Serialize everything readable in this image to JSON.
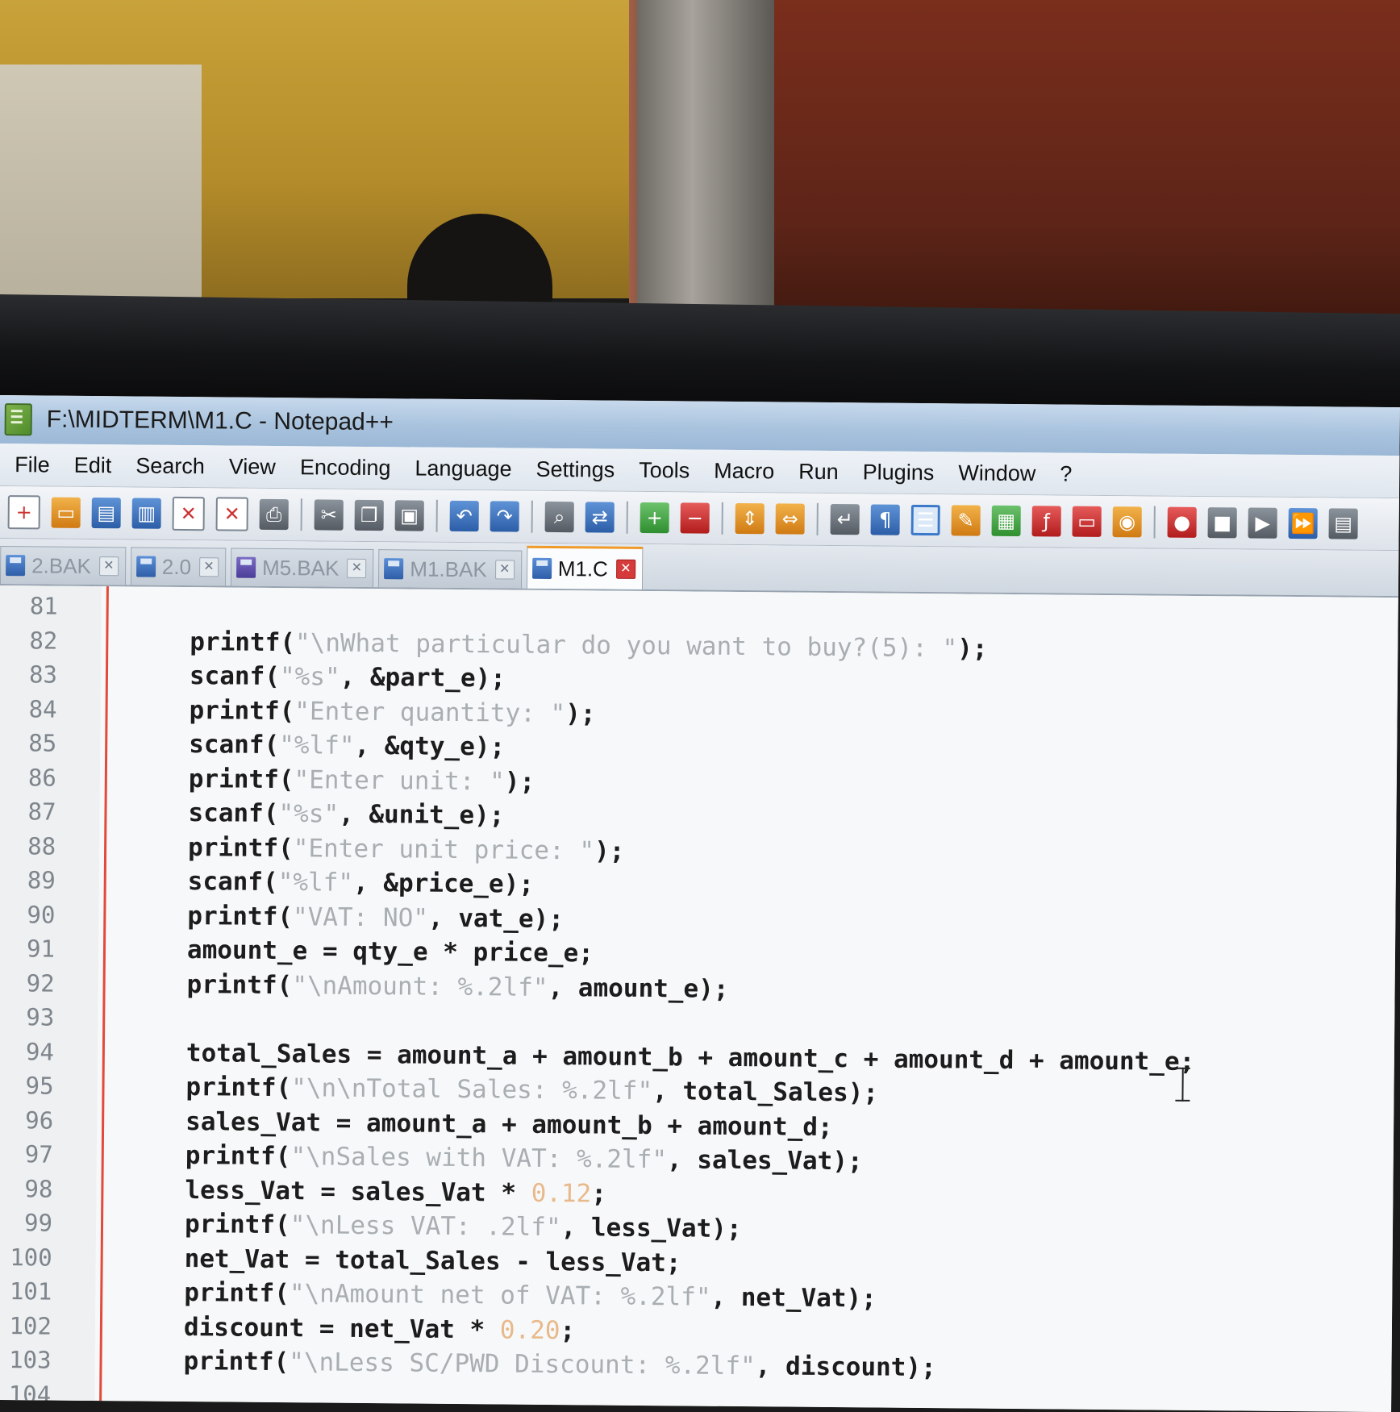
{
  "window": {
    "title": "F:\\MIDTERM\\M1.C - Notepad++"
  },
  "menu": [
    "File",
    "Edit",
    "Search",
    "View",
    "Encoding",
    "Language",
    "Settings",
    "Tools",
    "Macro",
    "Run",
    "Plugins",
    "Window",
    "?"
  ],
  "toolbar_icons": [
    "new-file-icon",
    "open-file-icon",
    "save-icon",
    "save-all-icon",
    "close-icon",
    "close-all-icon",
    "print-icon",
    "cut-icon",
    "copy-icon",
    "paste-icon",
    "undo-icon",
    "redo-icon",
    "find-icon",
    "replace-icon",
    "zoom-in-icon",
    "zoom-out-icon",
    "sync-vertical-icon",
    "sync-horizontal-icon",
    "word-wrap-icon",
    "show-all-characters-icon",
    "indent-guide-icon",
    "user-defined-language-icon",
    "document-map-icon",
    "function-list-icon",
    "folder-as-workspace-icon",
    "monitoring-icon",
    "record-macro-icon",
    "stop-recording-icon",
    "play-macro-icon",
    "run-macro-multiple-icon",
    "save-macro-icon"
  ],
  "tabs": [
    {
      "label": "2.BAK",
      "active": false
    },
    {
      "label": "2.0",
      "active": false
    },
    {
      "label": "M5.BAK",
      "active": false
    },
    {
      "label": "M1.BAK",
      "active": false
    },
    {
      "label": "M1.C",
      "active": true
    }
  ],
  "colors": {
    "fold_margin_line": "#e24a3b",
    "active_tab_accent": "#f09a2a",
    "string_literal": "#a9aeb3",
    "number_literal": "#e8b98a"
  },
  "lines": [
    {
      "n": "81",
      "code": ""
    },
    {
      "n": "82",
      "pre": "printf(",
      "str": "\"\\nWhat particular do you want to buy?(5): \"",
      "post": ");"
    },
    {
      "n": "83",
      "pre": "scanf(",
      "str": "\"%s\"",
      "post": ", &part_e);"
    },
    {
      "n": "84",
      "pre": "printf(",
      "str": "\"Enter quantity: \"",
      "post": ");"
    },
    {
      "n": "85",
      "pre": "scanf(",
      "str": "\"%lf\"",
      "post": ", &qty_e);"
    },
    {
      "n": "86",
      "pre": "printf(",
      "str": "\"Enter unit: \"",
      "post": ");"
    },
    {
      "n": "87",
      "pre": "scanf(",
      "str": "\"%s\"",
      "post": ", &unit_e);"
    },
    {
      "n": "88",
      "pre": "printf(",
      "str": "\"Enter unit price: \"",
      "post": ");"
    },
    {
      "n": "89",
      "pre": "scanf(",
      "str": "\"%lf\"",
      "post": ", &price_e);"
    },
    {
      "n": "90",
      "pre": "printf(",
      "str": "\"VAT: NO\"",
      "post": ", vat_e);"
    },
    {
      "n": "91",
      "pre": "amount_e = qty_e * price_e;",
      "str": "",
      "post": ""
    },
    {
      "n": "92",
      "pre": "printf(",
      "str": "\"\\nAmount: %.2lf\"",
      "post": ", amount_e);"
    },
    {
      "n": "93",
      "code": ""
    },
    {
      "n": "94",
      "pre": "total_Sales = amount_a + amount_b + amount_c + amount_d + amount_e;",
      "str": "",
      "post": ""
    },
    {
      "n": "95",
      "pre": "printf(",
      "str": "\"\\n\\nTotal Sales: %.2lf\"",
      "post": ", total_Sales);"
    },
    {
      "n": "96",
      "pre": "sales_Vat = amount_a + amount_b + amount_d;",
      "str": "",
      "post": ""
    },
    {
      "n": "97",
      "pre": "printf(",
      "str": "\"\\nSales with VAT: %.2lf\"",
      "post": ", sales_Vat);"
    },
    {
      "n": "98",
      "pre": "less_Vat = sales_Vat * ",
      "num": "0.12",
      "post": ";"
    },
    {
      "n": "99",
      "pre": "printf(",
      "str": "\"\\nLess VAT: .2lf\"",
      "post": ", less_Vat);"
    },
    {
      "n": "100",
      "pre": "net_Vat = total_Sales - less_Vat;",
      "str": "",
      "post": ""
    },
    {
      "n": "101",
      "pre": "printf(",
      "str": "\"\\nAmount net of VAT: %.2lf\"",
      "post": ", net_Vat);"
    },
    {
      "n": "102",
      "pre": "discount = net_Vat * ",
      "num": "0.20",
      "post": ";"
    },
    {
      "n": "103",
      "pre": "printf(",
      "str": "\"\\nLess SC/PWD Discount: %.2lf\"",
      "post": ", discount);"
    },
    {
      "n": "104",
      "code": ""
    }
  ]
}
